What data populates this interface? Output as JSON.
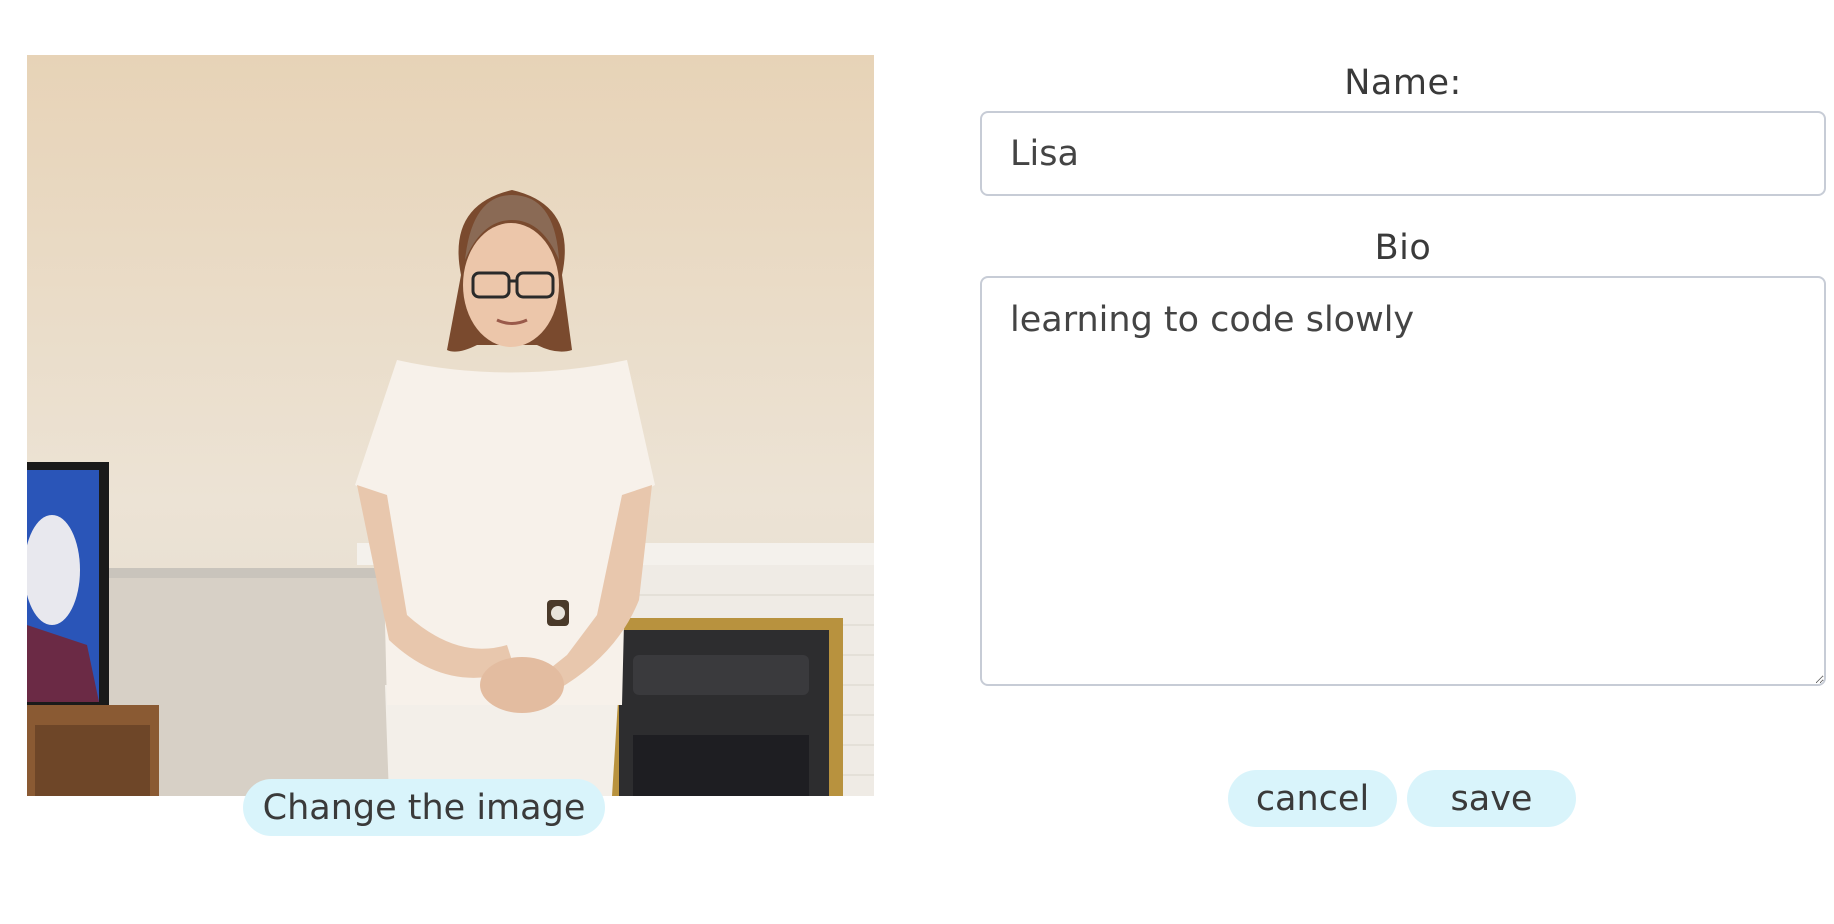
{
  "profile": {
    "change_image_label": "Change the image"
  },
  "form": {
    "name_label": "Name:",
    "name_value": "Lisa",
    "bio_label": "Bio",
    "bio_value": "learning to code slowly",
    "cancel_label": "cancel",
    "save_label": "save"
  },
  "colors": {
    "button_bg": "#d9f4fb",
    "input_border": "#c7ccd6",
    "text": "#333333"
  }
}
